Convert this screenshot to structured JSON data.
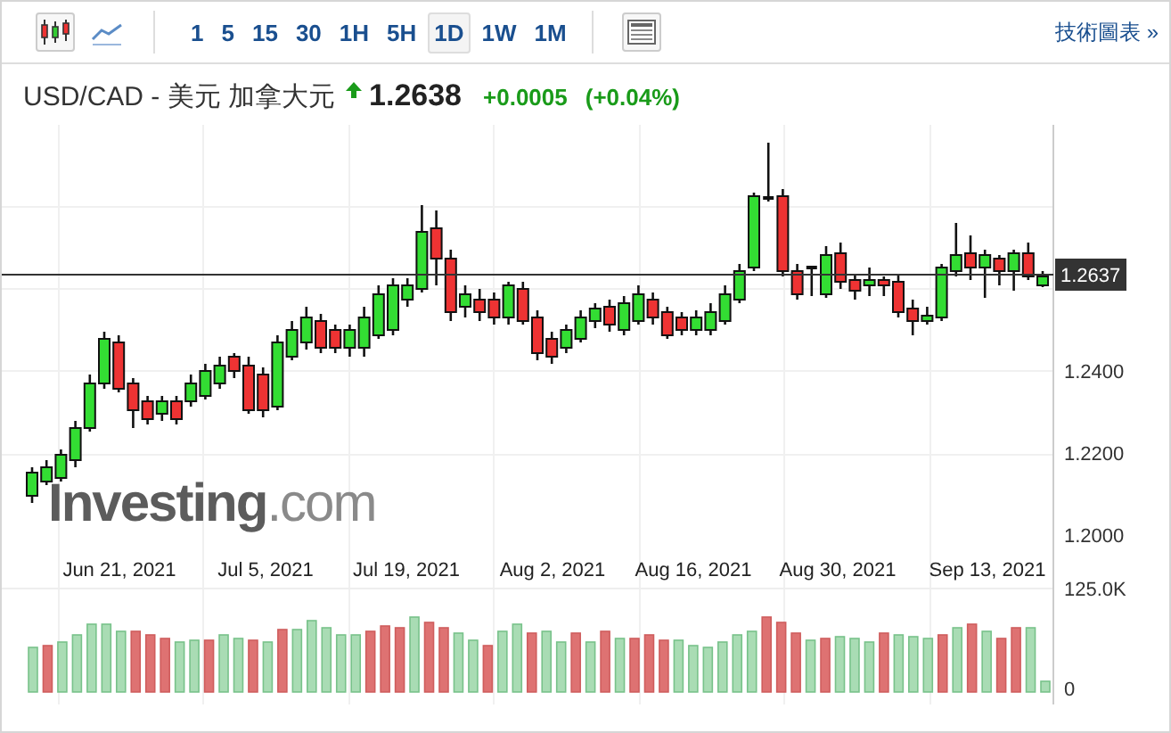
{
  "toolbar": {
    "chart_types": [
      {
        "kind": "candlestick",
        "selected": true
      },
      {
        "kind": "line",
        "selected": false
      }
    ],
    "intervals": [
      {
        "label": "1",
        "selected": false
      },
      {
        "label": "5",
        "selected": false
      },
      {
        "label": "15",
        "selected": false
      },
      {
        "label": "30",
        "selected": false
      },
      {
        "label": "1H",
        "selected": false
      },
      {
        "label": "5H",
        "selected": false
      },
      {
        "label": "1D",
        "selected": true
      },
      {
        "label": "1W",
        "selected": false
      },
      {
        "label": "1M",
        "selected": false
      }
    ],
    "link": "技術圖表 »"
  },
  "quote": {
    "symbol": "USD/CAD - 美元 加拿大元",
    "rising": true,
    "price": "1.2638",
    "change": "+0.0005",
    "change_percent": "(+0.04%)"
  },
  "chart": {
    "y_ticks": [
      "1.2400",
      "1.2200",
      "1.2000"
    ],
    "current_price": "1.2637",
    "x_labels": [
      "Jun 21, 2021",
      "Jul 5, 2021",
      "Jul 19, 2021",
      "Aug 2, 2021",
      "Aug 16, 2021",
      "Aug 30, 2021",
      "Sep 13, 2021"
    ],
    "volume_ticks": [
      "125.0K",
      "0"
    ],
    "logo": "**Investing**.com"
  }
}
